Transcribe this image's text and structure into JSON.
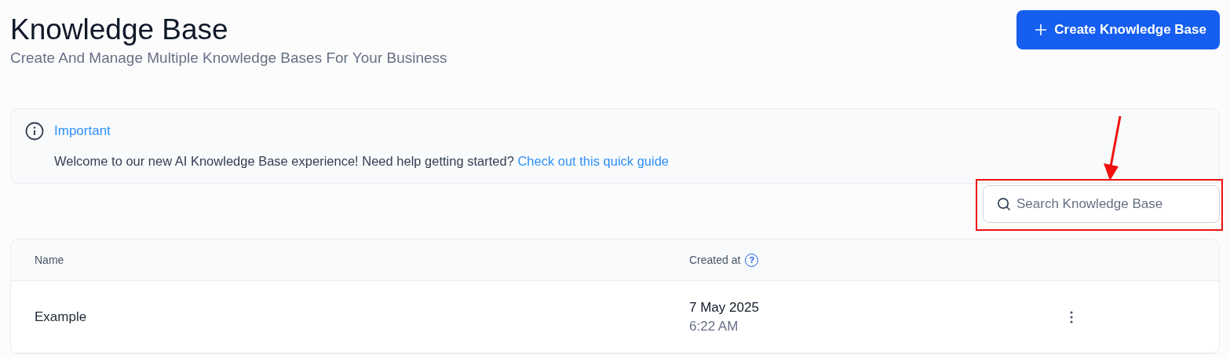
{
  "header": {
    "title": "Knowledge Base",
    "subtitle": "Create And Manage Multiple Knowledge Bases For Your Business",
    "create_button": "Create Knowledge Base"
  },
  "alert": {
    "title": "Important",
    "message": "Welcome to our new AI Knowledge Base experience! Need help getting started?",
    "link": "Check out this quick guide"
  },
  "search": {
    "placeholder": "Search Knowledge Base"
  },
  "table": {
    "columns": [
      {
        "label": "Name"
      },
      {
        "label": "Created at",
        "help_glyph": "?"
      }
    ],
    "rows": [
      {
        "name": "Example",
        "date": "7 May 2025",
        "time": "6:22 AM"
      }
    ]
  }
}
